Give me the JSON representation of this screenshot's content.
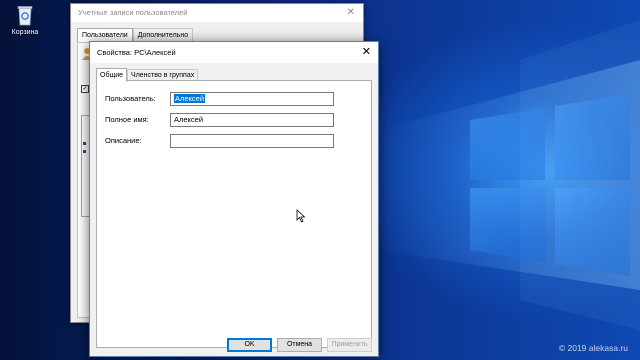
{
  "desktop": {
    "recycle_bin_label": "Корзина",
    "watermark": "© 2019 alekasa.ru"
  },
  "background_window": {
    "title": "Учетные записи пользователей",
    "tabs": [
      {
        "label": "Пользователи",
        "active": true
      },
      {
        "label": "Дополнительно",
        "active": false
      }
    ]
  },
  "dialog": {
    "title": "Свойства: PC\\Алексей",
    "tabs": [
      {
        "label": "Общие",
        "active": true
      },
      {
        "label": "Членство в группах",
        "active": false
      }
    ],
    "fields": {
      "username": {
        "label": "Пользователь:",
        "value": "Алексей"
      },
      "fullname": {
        "label": "Полное имя:",
        "value": "Алексей"
      },
      "description": {
        "label": "Описание:",
        "value": ""
      }
    },
    "buttons": {
      "ok": "OK",
      "cancel": "Отмена",
      "apply": "Применить"
    }
  },
  "colors": {
    "selection": "#0078d7",
    "desktop_dark": "#061f5a",
    "desktop_light": "#2f8ef0"
  }
}
